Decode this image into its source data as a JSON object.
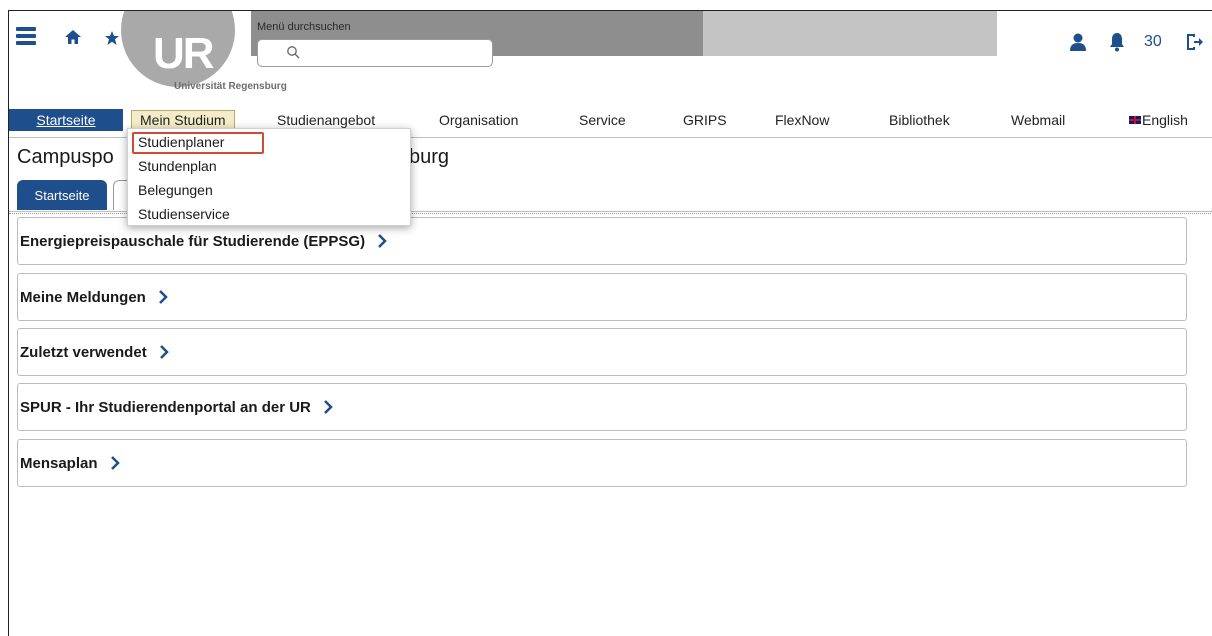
{
  "header": {
    "university_name": "Universität Regensburg",
    "logo_text": "UR",
    "search_label": "Menü durchsuchen",
    "notification_count": "30",
    "colors": {
      "brand_blue": "#1f4e8c",
      "bar_dark": "#8e8e8e",
      "bar_light": "#c4c4c4"
    }
  },
  "nav": {
    "items": [
      "Startseite",
      "Mein Studium",
      "Studienangebot",
      "Organisation",
      "Service",
      "GRIPS",
      "FlexNow",
      "Bibliothek",
      "Webmail",
      "English"
    ],
    "active": "Startseite",
    "open": "Mein Studium"
  },
  "dropdown": {
    "items": [
      "Studienplaner",
      "Stundenplan",
      "Belegungen",
      "Studienservice"
    ],
    "highlighted": "Studienplaner"
  },
  "portal": {
    "title_left": "Campuspo",
    "title_right": "burg",
    "tab": "Startseite"
  },
  "sections": [
    "Energiepreispauschale für Studierende (EPPSG)",
    "Meine Meldungen",
    "Zuletzt verwendet",
    "SPUR - Ihr Studierendenportal an der UR",
    "Mensaplan"
  ]
}
